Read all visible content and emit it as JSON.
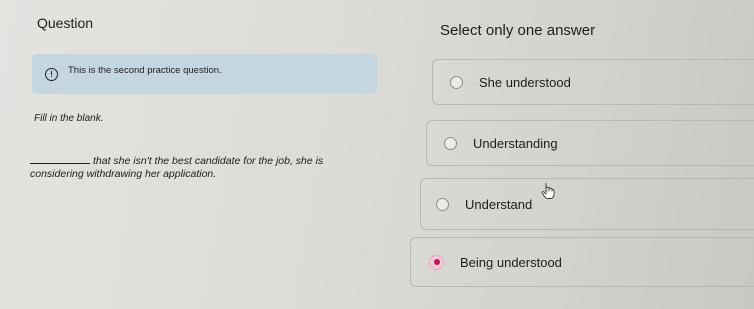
{
  "question": {
    "title": "Question"
  },
  "instruction": "Select only one answer",
  "info": {
    "icon": "info-icon",
    "text": "This is the second practice question."
  },
  "prompt": {
    "label": "Fill in the blank.",
    "sentence": "that she isn't the best candidate for the job, she is considering withdrawing her application."
  },
  "options": [
    {
      "label": "She understood",
      "selected": false
    },
    {
      "label": "Understanding",
      "selected": false
    },
    {
      "label": "Understand",
      "selected": false
    },
    {
      "label": "Being understood",
      "selected": true
    }
  ],
  "colors": {
    "banner": "#c4d7e0",
    "selected_radio": "#c2185b",
    "selected_radio_ring": "#f2c9d6"
  }
}
